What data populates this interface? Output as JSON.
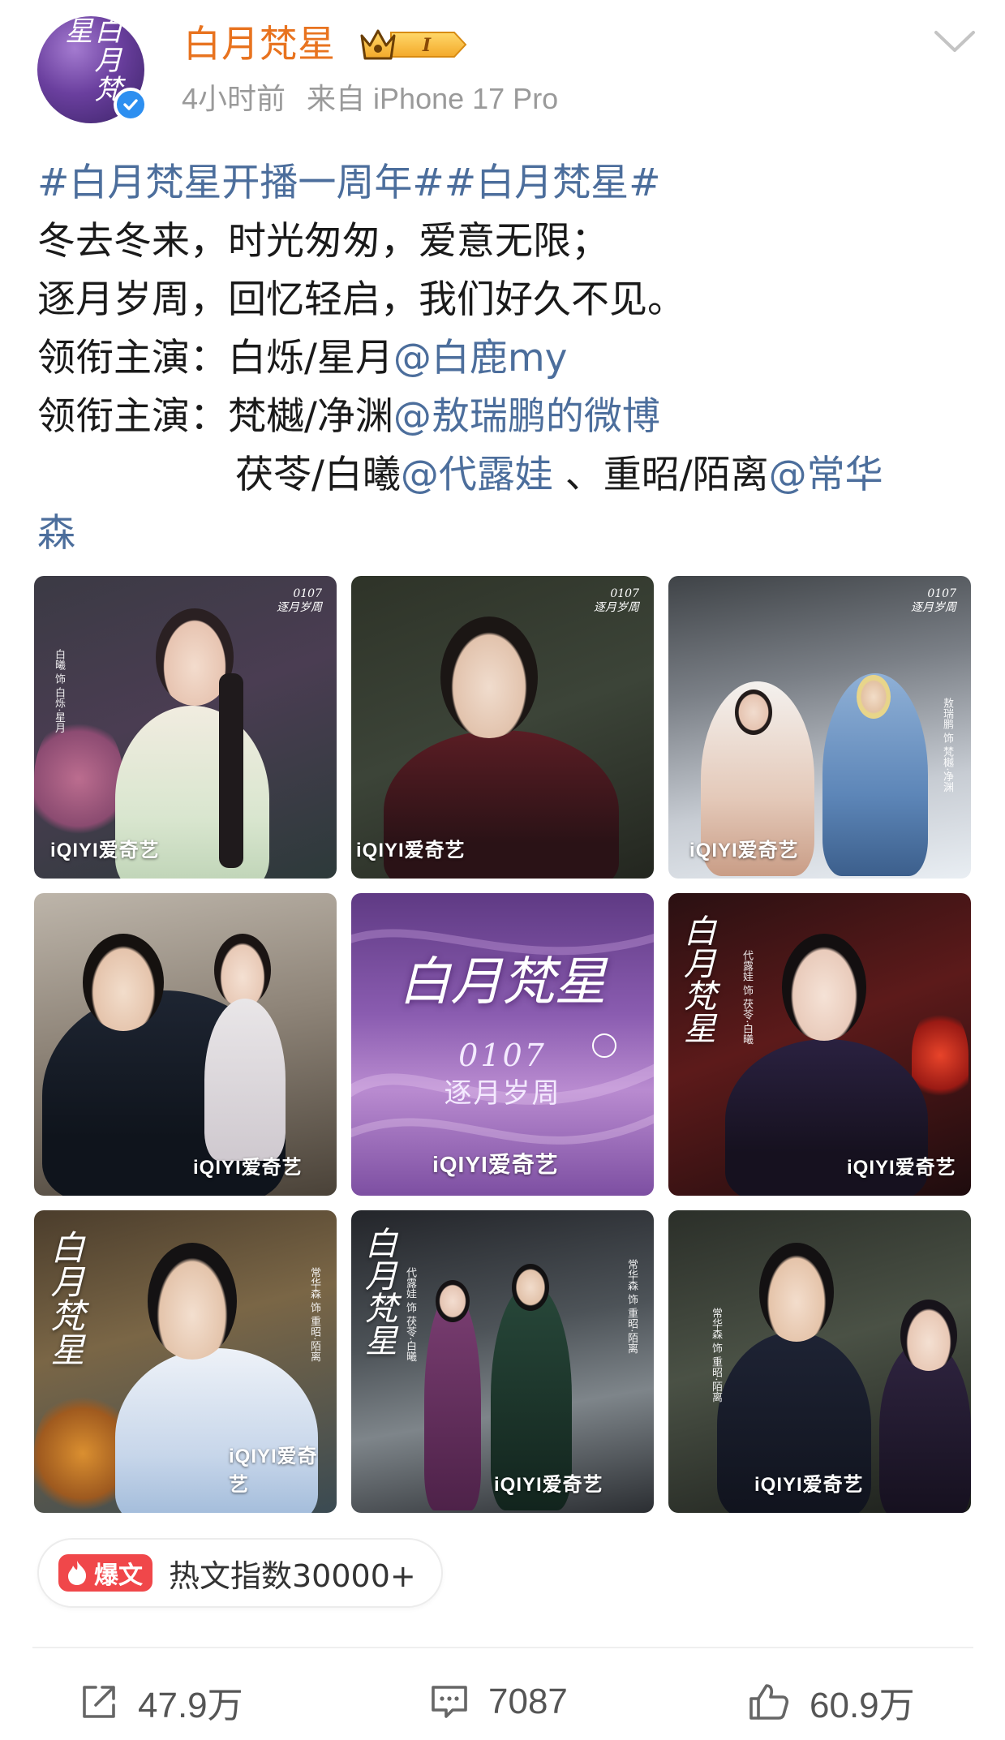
{
  "post": {
    "author": {
      "name": "白月梵星",
      "avatar_text": "白月梵星",
      "vip_level": "I",
      "verified": true
    },
    "time": "4小时前",
    "source": "来自 iPhone 17 Pro",
    "lines": {
      "tag1": "#白月梵星开播一周年#",
      "tag2": "#白月梵星#",
      "l2": "冬去冬来，时光匆匆，爱意无限；",
      "l3": "逐月岁周，回忆轻启，我们好久不见。",
      "l4_prefix": "领衔主演：白烁/星月",
      "l4_mention": "@白鹿my",
      "l5_prefix": "领衔主演：梵樾/净渊",
      "l5_mention": "@敖瑞鹏的微博",
      "l6_prefix": "茯苓/白曦",
      "l6_mention": "@代露娃",
      "l6_mid": " 、重昭/陌离",
      "l6_mention2": "@常华",
      "l7_mention": "森"
    },
    "images": {
      "logo": "iQIYI爱奇艺",
      "stamp_date": "0107",
      "stamp_text": "逐月岁周",
      "poster_title": "白月梵星",
      "poster_date": "0107",
      "poster_sub": "逐月岁周",
      "calligraphy": "白月梵星",
      "captions": {
        "t1": "白曦 饰 白烁·星月",
        "t3": "敖瑞鹏 饰 梵樾·净渊",
        "t6": "代露娃 饰 茯苓·白曦",
        "t7": "常华森 饰 重昭·陌离",
        "t8a": "代露娃 饰 茯苓·白曦",
        "t8b": "常华森 饰 重昭·陌离",
        "t9": "常华森 饰 重昭·陌离"
      }
    },
    "hot": {
      "badge": "爆文",
      "text": "热文指数30000+"
    },
    "actions": {
      "repost_count": "47.9万",
      "comment_count": "7087",
      "like_count": "60.9万"
    }
  },
  "colors": {
    "username": "#e8731f",
    "link": "#4c6e9c",
    "hot_badge": "#f0474a",
    "meta": "#9a9a9a"
  },
  "icons": [
    "verified-icon",
    "vip-crown-icon",
    "chevron-down-icon",
    "flame-icon",
    "repost-icon",
    "comment-icon",
    "like-icon"
  ]
}
